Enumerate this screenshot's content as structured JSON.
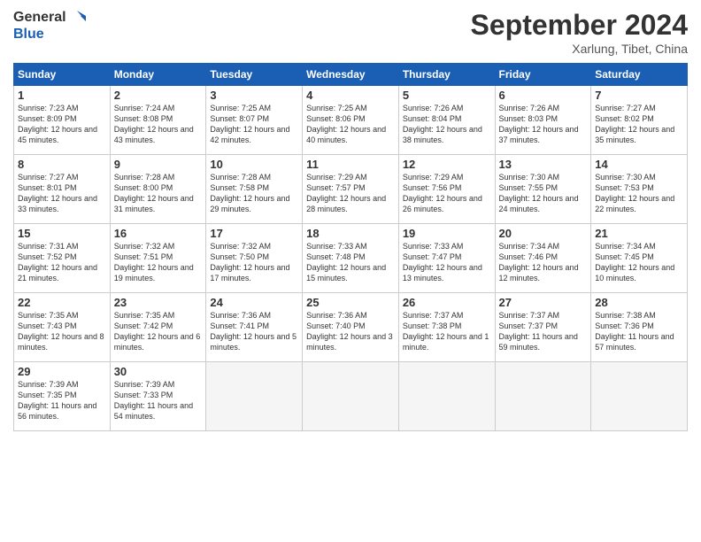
{
  "header": {
    "logo_line1": "General",
    "logo_line2": "Blue",
    "month": "September 2024",
    "location": "Xarlung, Tibet, China"
  },
  "weekdays": [
    "Sunday",
    "Monday",
    "Tuesday",
    "Wednesday",
    "Thursday",
    "Friday",
    "Saturday"
  ],
  "weeks": [
    [
      {
        "day": "1",
        "sunrise": "7:23 AM",
        "sunset": "8:09 PM",
        "daylight": "12 hours and 45 minutes."
      },
      {
        "day": "2",
        "sunrise": "7:24 AM",
        "sunset": "8:08 PM",
        "daylight": "12 hours and 43 minutes."
      },
      {
        "day": "3",
        "sunrise": "7:25 AM",
        "sunset": "8:07 PM",
        "daylight": "12 hours and 42 minutes."
      },
      {
        "day": "4",
        "sunrise": "7:25 AM",
        "sunset": "8:06 PM",
        "daylight": "12 hours and 40 minutes."
      },
      {
        "day": "5",
        "sunrise": "7:26 AM",
        "sunset": "8:04 PM",
        "daylight": "12 hours and 38 minutes."
      },
      {
        "day": "6",
        "sunrise": "7:26 AM",
        "sunset": "8:03 PM",
        "daylight": "12 hours and 37 minutes."
      },
      {
        "day": "7",
        "sunrise": "7:27 AM",
        "sunset": "8:02 PM",
        "daylight": "12 hours and 35 minutes."
      }
    ],
    [
      {
        "day": "8",
        "sunrise": "7:27 AM",
        "sunset": "8:01 PM",
        "daylight": "12 hours and 33 minutes."
      },
      {
        "day": "9",
        "sunrise": "7:28 AM",
        "sunset": "8:00 PM",
        "daylight": "12 hours and 31 minutes."
      },
      {
        "day": "10",
        "sunrise": "7:28 AM",
        "sunset": "7:58 PM",
        "daylight": "12 hours and 29 minutes."
      },
      {
        "day": "11",
        "sunrise": "7:29 AM",
        "sunset": "7:57 PM",
        "daylight": "12 hours and 28 minutes."
      },
      {
        "day": "12",
        "sunrise": "7:29 AM",
        "sunset": "7:56 PM",
        "daylight": "12 hours and 26 minutes."
      },
      {
        "day": "13",
        "sunrise": "7:30 AM",
        "sunset": "7:55 PM",
        "daylight": "12 hours and 24 minutes."
      },
      {
        "day": "14",
        "sunrise": "7:30 AM",
        "sunset": "7:53 PM",
        "daylight": "12 hours and 22 minutes."
      }
    ],
    [
      {
        "day": "15",
        "sunrise": "7:31 AM",
        "sunset": "7:52 PM",
        "daylight": "12 hours and 21 minutes."
      },
      {
        "day": "16",
        "sunrise": "7:32 AM",
        "sunset": "7:51 PM",
        "daylight": "12 hours and 19 minutes."
      },
      {
        "day": "17",
        "sunrise": "7:32 AM",
        "sunset": "7:50 PM",
        "daylight": "12 hours and 17 minutes."
      },
      {
        "day": "18",
        "sunrise": "7:33 AM",
        "sunset": "7:48 PM",
        "daylight": "12 hours and 15 minutes."
      },
      {
        "day": "19",
        "sunrise": "7:33 AM",
        "sunset": "7:47 PM",
        "daylight": "12 hours and 13 minutes."
      },
      {
        "day": "20",
        "sunrise": "7:34 AM",
        "sunset": "7:46 PM",
        "daylight": "12 hours and 12 minutes."
      },
      {
        "day": "21",
        "sunrise": "7:34 AM",
        "sunset": "7:45 PM",
        "daylight": "12 hours and 10 minutes."
      }
    ],
    [
      {
        "day": "22",
        "sunrise": "7:35 AM",
        "sunset": "7:43 PM",
        "daylight": "12 hours and 8 minutes."
      },
      {
        "day": "23",
        "sunrise": "7:35 AM",
        "sunset": "7:42 PM",
        "daylight": "12 hours and 6 minutes."
      },
      {
        "day": "24",
        "sunrise": "7:36 AM",
        "sunset": "7:41 PM",
        "daylight": "12 hours and 5 minutes."
      },
      {
        "day": "25",
        "sunrise": "7:36 AM",
        "sunset": "7:40 PM",
        "daylight": "12 hours and 3 minutes."
      },
      {
        "day": "26",
        "sunrise": "7:37 AM",
        "sunset": "7:38 PM",
        "daylight": "12 hours and 1 minute."
      },
      {
        "day": "27",
        "sunrise": "7:37 AM",
        "sunset": "7:37 PM",
        "daylight": "11 hours and 59 minutes."
      },
      {
        "day": "28",
        "sunrise": "7:38 AM",
        "sunset": "7:36 PM",
        "daylight": "11 hours and 57 minutes."
      }
    ],
    [
      {
        "day": "29",
        "sunrise": "7:39 AM",
        "sunset": "7:35 PM",
        "daylight": "11 hours and 56 minutes."
      },
      {
        "day": "30",
        "sunrise": "7:39 AM",
        "sunset": "7:33 PM",
        "daylight": "11 hours and 54 minutes."
      },
      null,
      null,
      null,
      null,
      null
    ]
  ]
}
